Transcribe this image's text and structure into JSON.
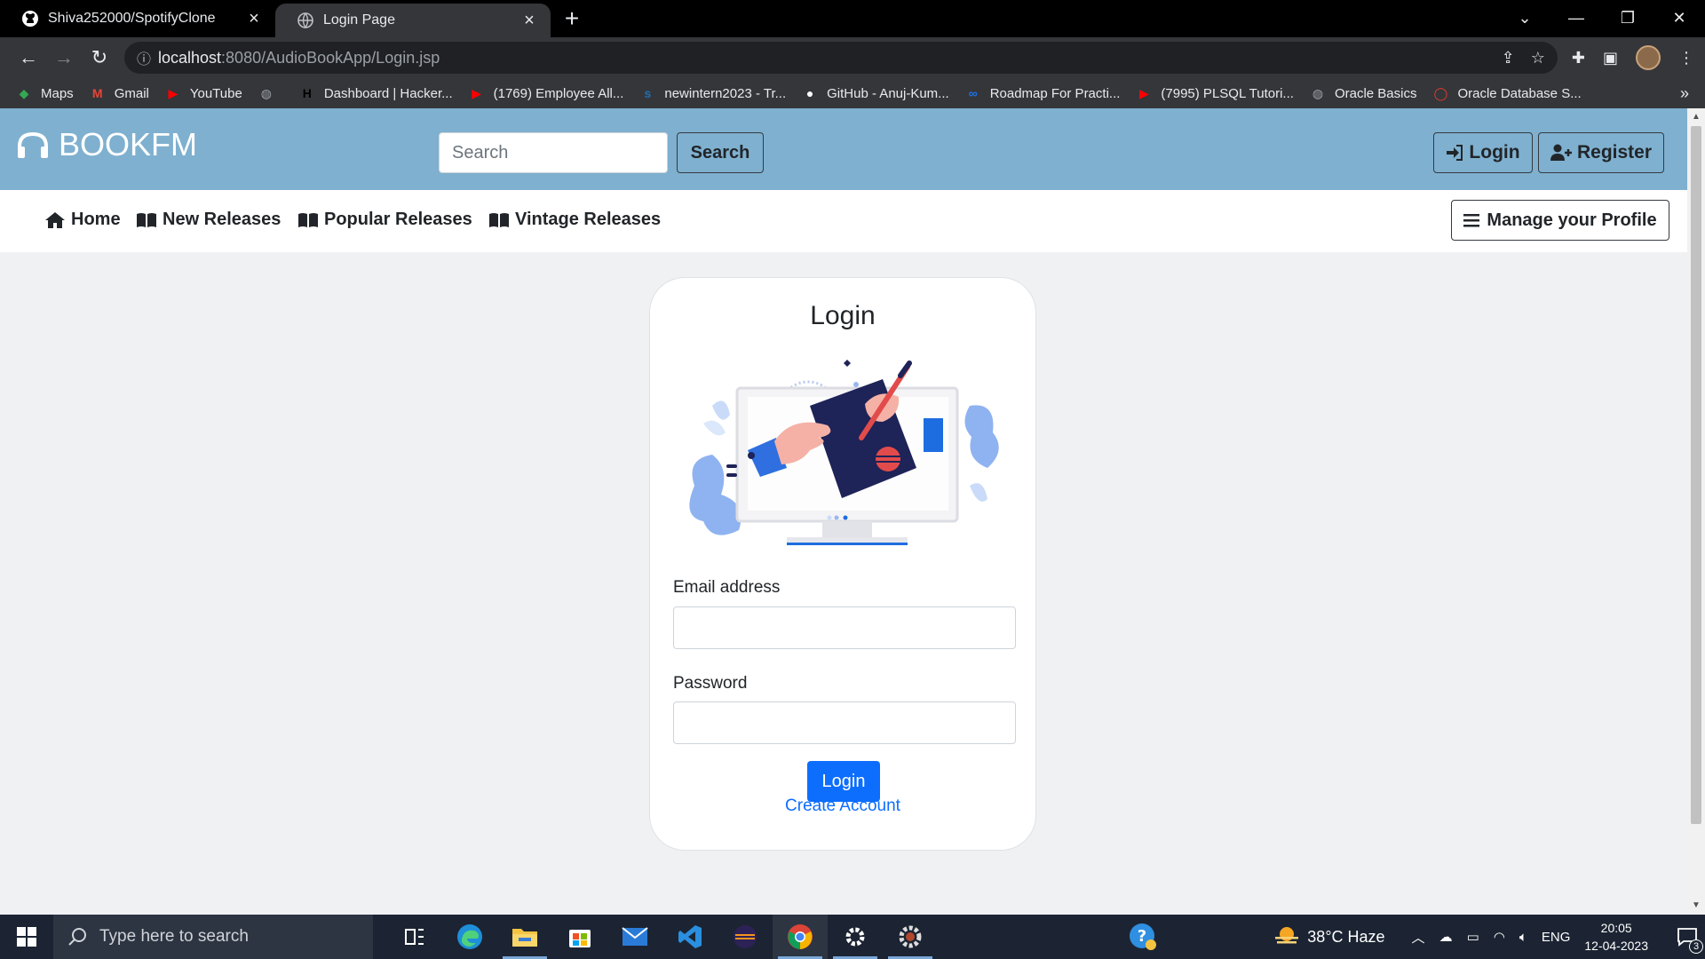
{
  "browser": {
    "tabs": [
      {
        "title": "Shiva252000/SpotifyClone",
        "icon": "github-icon",
        "active": false
      },
      {
        "title": "Login Page",
        "icon": "globe-icon",
        "active": true
      }
    ],
    "url_host": "localhost",
    "url_path": ":8080/AudioBookApp/Login.jsp",
    "bookmarks": [
      {
        "label": "Maps",
        "icon": "maps-icon",
        "color": "#34a853"
      },
      {
        "label": "Gmail",
        "icon": "gmail-icon",
        "color": "#ea4335"
      },
      {
        "label": "YouTube",
        "icon": "youtube-icon",
        "color": "#ff0000"
      },
      {
        "label": "",
        "icon": "globe-icon",
        "color": "#9aa0a6"
      },
      {
        "label": "Dashboard | Hacker...",
        "icon": "hackerrank-icon",
        "color": "#000000"
      },
      {
        "label": "(1769) Employee All...",
        "icon": "youtube-icon",
        "color": "#ff0000"
      },
      {
        "label": "newintern2023 - Tr...",
        "icon": "trello-icon",
        "color": "#1f6fb3"
      },
      {
        "label": "GitHub - Anuj-Kum...",
        "icon": "github-icon",
        "color": "#ffffff"
      },
      {
        "label": "Roadmap For Practi...",
        "icon": "roadmap-icon",
        "color": "#1a73e8"
      },
      {
        "label": "(7995) PLSQL Tutori...",
        "icon": "youtube-icon",
        "color": "#ff0000"
      },
      {
        "label": "Oracle Basics",
        "icon": "globe-icon",
        "color": "#9aa0a6"
      },
      {
        "label": "Oracle Database S...",
        "icon": "oracle-icon",
        "color": "#e23b2f"
      }
    ]
  },
  "site": {
    "brand": "BOOKFM",
    "search_placeholder": "Search",
    "search_button": "Search",
    "login_button": "Login",
    "register_button": "Register",
    "nav": [
      {
        "label": "Home",
        "icon": "home-icon"
      },
      {
        "label": "New Releases",
        "icon": "book-icon"
      },
      {
        "label": "Popular Releases",
        "icon": "book-icon"
      },
      {
        "label": "Vintage Releases",
        "icon": "book-icon"
      }
    ],
    "manage_profile": "Manage your Profile"
  },
  "login_card": {
    "title": "Login",
    "email_label": "Email address",
    "email_value": "",
    "password_label": "Password",
    "password_value": "",
    "submit": "Login",
    "create_account": "Create Account",
    "accent_color": "#0d6efd"
  },
  "taskbar": {
    "search_placeholder": "Type here to search",
    "weather": "38°C  Haze",
    "language": "ENG",
    "time": "20:05",
    "date": "12-04-2023",
    "notifications": "3"
  }
}
